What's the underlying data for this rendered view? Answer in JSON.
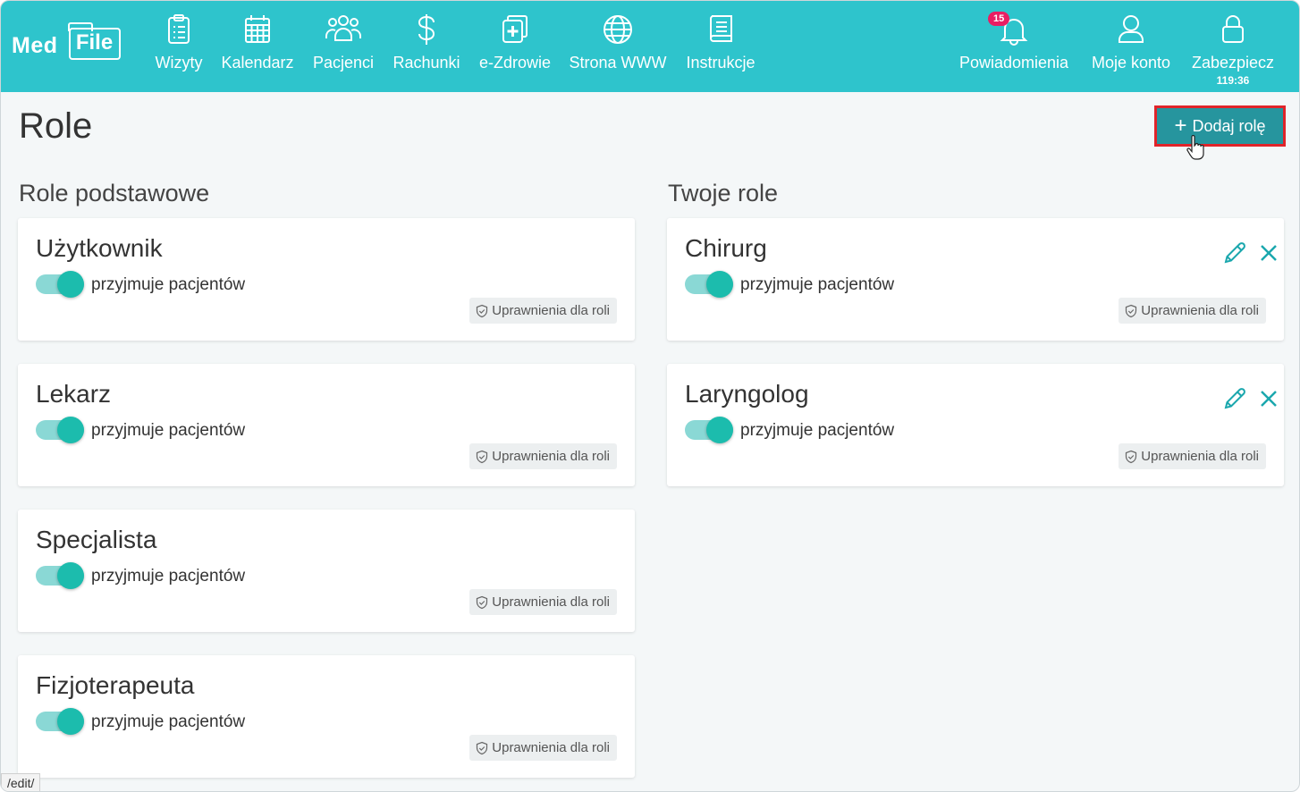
{
  "app": {
    "logo_text_med": "Med",
    "logo_text_file": "File"
  },
  "nav": {
    "items": [
      {
        "label": "Wizyty",
        "icon": "clipboard-icon"
      },
      {
        "label": "Kalendarz",
        "icon": "calendar-icon"
      },
      {
        "label": "Pacjenci",
        "icon": "users-icon"
      },
      {
        "label": "Rachunki",
        "icon": "dollar-icon"
      },
      {
        "label": "e-Zdrowie",
        "icon": "health-plus-icon"
      },
      {
        "label": "Strona WWW",
        "icon": "globe-icon"
      },
      {
        "label": "Instrukcje",
        "icon": "book-icon"
      }
    ],
    "right": {
      "notifications_label": "Powiadomienia",
      "notifications_count": "15",
      "account_label": "Moje konto",
      "lock_label": "Zabezpiecz",
      "lock_timer": "119:36"
    }
  },
  "page": {
    "title": "Role",
    "add_button_label": "Dodaj rolę"
  },
  "basic_roles": {
    "title": "Role podstawowe",
    "items": [
      {
        "name": "Użytkownik",
        "accepts_label": "przyjmuje pacjentów",
        "permissions_label": "Uprawnienia dla roli",
        "accepts": true
      },
      {
        "name": "Lekarz",
        "accepts_label": "przyjmuje pacjentów",
        "permissions_label": "Uprawnienia dla roli",
        "accepts": true
      },
      {
        "name": "Specjalista",
        "accepts_label": "przyjmuje pacjentów",
        "permissions_label": "Uprawnienia dla roli",
        "accepts": true
      },
      {
        "name": "Fizjoterapeuta",
        "accepts_label": "przyjmuje pacjentów",
        "permissions_label": "Uprawnienia dla roli",
        "accepts": true
      }
    ]
  },
  "your_roles": {
    "title": "Twoje role",
    "items": [
      {
        "name": "Chirurg",
        "accepts_label": "przyjmuje pacjentów",
        "permissions_label": "Uprawnienia dla roli",
        "accepts": true
      },
      {
        "name": "Laryngolog",
        "accepts_label": "przyjmuje pacjentów",
        "permissions_label": "Uprawnienia dla roli",
        "accepts": true
      }
    ]
  },
  "status_bar": {
    "url": "/edit/"
  },
  "colors": {
    "topbar": "#2ec4cc",
    "accent_button": "#26959e",
    "highlight_border": "#e0242a",
    "toggle_on": "#1cbcad",
    "badge": "#e91e63"
  }
}
